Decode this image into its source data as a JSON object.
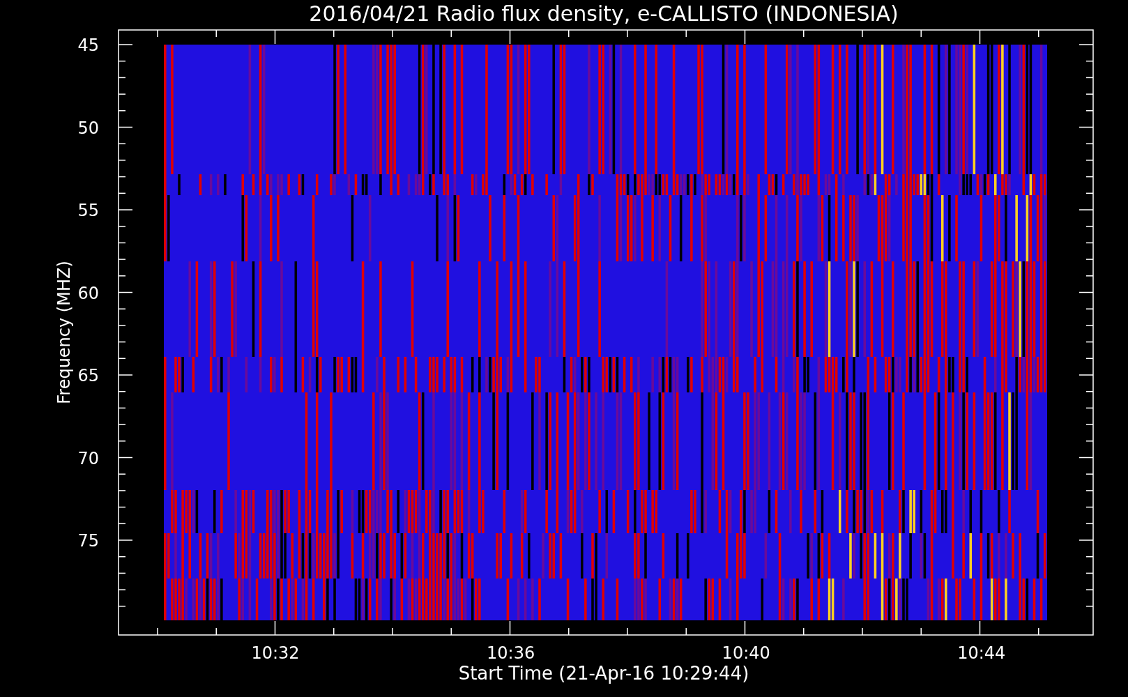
{
  "title": "2016/04/21  Radio flux density, e-CALLISTO (INDONESIA)",
  "y_axis": {
    "label": "Frequency (MHZ)",
    "ticks": [
      "45",
      "50",
      "55",
      "60",
      "65",
      "70",
      "75"
    ]
  },
  "x_axis": {
    "label": "Start Time (21-Apr-16 10:29:44)",
    "ticks": [
      "10:32",
      "10:36",
      "10:40",
      "10:44"
    ]
  }
}
